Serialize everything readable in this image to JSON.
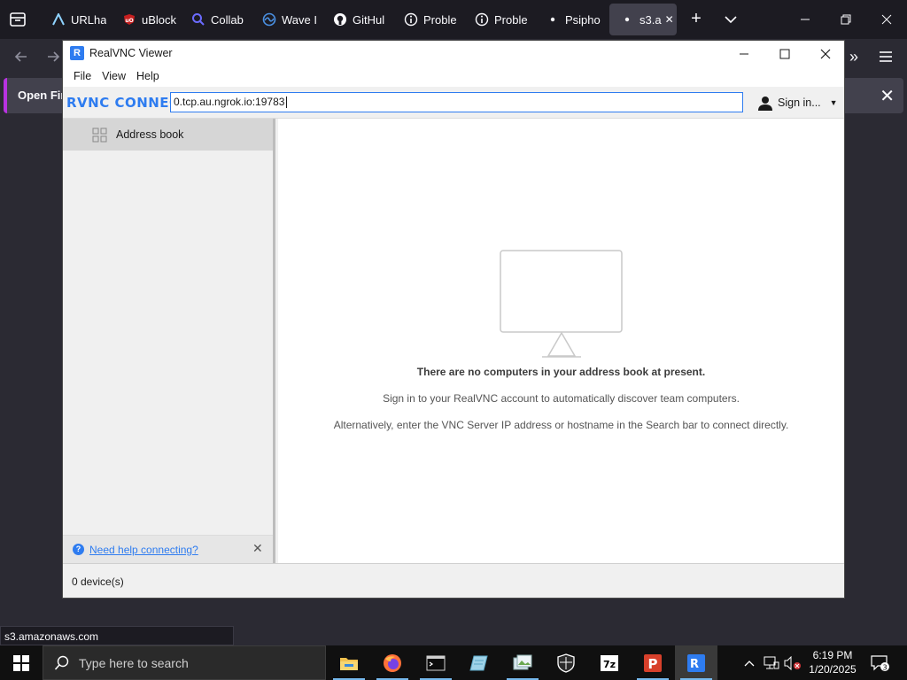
{
  "browser": {
    "tabs": [
      {
        "label": "URLha",
        "icon": "urlhaus-icon",
        "color": "#8fd3ff"
      },
      {
        "label": "uBlock",
        "icon": "ublock-icon",
        "color": "#c71f1f"
      },
      {
        "label": "Collab",
        "icon": "search-icon",
        "color": "#6b6bff"
      },
      {
        "label": "Wave I",
        "icon": "wave-icon",
        "color": "#4a90e2"
      },
      {
        "label": "GitHul",
        "icon": "github-icon",
        "color": "#ffffff"
      },
      {
        "label": "Proble",
        "icon": "info-icon",
        "color": "#ffffff"
      },
      {
        "label": "Proble",
        "icon": "info-icon",
        "color": "#ffffff"
      },
      {
        "label": "Psipho",
        "icon": "dot-icon",
        "color": "#ffffff"
      },
      {
        "label": "s3.a",
        "icon": "dot-icon",
        "color": "#ffffff",
        "active": true
      }
    ],
    "notification": "Open Fire",
    "status_url": "s3.amazonaws.com"
  },
  "vnc": {
    "title": "RealVNC Viewer",
    "menu": [
      "File",
      "View",
      "Help"
    ],
    "brand": "RVNC CONNECT",
    "search_value": "0.tcp.au.ngrok.io:19783",
    "signin_label": "Sign in...",
    "sidebar_item": "Address book",
    "help_link": "Need help connecting?",
    "empty_title": "There are no computers in your address book at present.",
    "empty_line1": "Sign in to your RealVNC account to automatically discover team computers.",
    "empty_line2": "Alternatively, enter the VNC Server IP address or hostname in the Search bar to connect directly.",
    "status": "0 device(s)",
    "accent": "#2e7cf0"
  },
  "taskbar": {
    "search_placeholder": "Type here to search",
    "time": "6:19 PM",
    "date": "1/20/2025",
    "notification_count": "3"
  }
}
